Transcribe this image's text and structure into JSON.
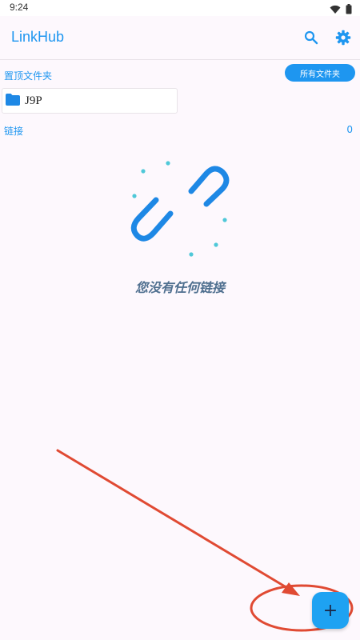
{
  "status_bar": {
    "time": "9:24"
  },
  "app_bar": {
    "title": "LinkHub",
    "search_icon": "search-icon",
    "settings_icon": "gear-icon"
  },
  "pinned": {
    "label": "置顶文件夹",
    "all_folders_button": "所有文件夹",
    "folders": [
      {
        "name": "J9P",
        "icon": "folder-icon"
      }
    ]
  },
  "links": {
    "label": "链接",
    "count": "0"
  },
  "empty_state": {
    "icon": "broken-link-icon",
    "message": "您没有任何链接"
  },
  "fab": {
    "label": "+"
  },
  "colors": {
    "accent": "#1e96f0",
    "background": "#fdf8fd",
    "annotation": "#e04a33"
  }
}
